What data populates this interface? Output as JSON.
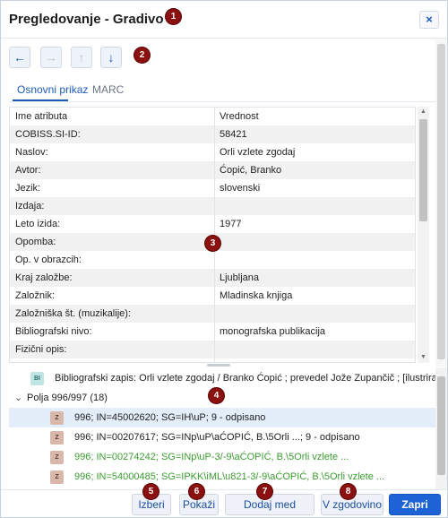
{
  "dialog": {
    "title": "Pregledovanje - Gradivo",
    "close_label": "×"
  },
  "nav": {
    "back_icon": "←",
    "forward_icon": "→",
    "up_icon": "↑",
    "down_icon": "↓"
  },
  "tabs": [
    {
      "label": "Osnovni prikaz",
      "active": true
    },
    {
      "label": "MARC",
      "active": false
    }
  ],
  "table": {
    "headers": [
      "Ime atributa",
      "Vrednost"
    ],
    "rows": [
      [
        "COBISS.SI-ID:",
        "58421"
      ],
      [
        "Naslov:",
        "Orli vzlete zgodaj"
      ],
      [
        "Avtor:",
        "Ćopić, Branko"
      ],
      [
        "Jezik:",
        "slovenski"
      ],
      [
        "Izdaja:",
        ""
      ],
      [
        "Leto izida:",
        "1977"
      ],
      [
        "Opomba:",
        ""
      ],
      [
        "Op. v obrazcih:",
        ""
      ],
      [
        "Kraj založbe:",
        "Ljubljana"
      ],
      [
        "Založnik:",
        "Mladinska knjiga"
      ],
      [
        "Založniška št. (muzikalije):",
        ""
      ],
      [
        "Bibliografski nivo:",
        "monografska publikacija"
      ],
      [
        "Fizični opis:",
        ""
      ]
    ]
  },
  "tree": {
    "bib_icon": "BI",
    "bib_text": "Bibliografski zapis: Orli vzlete zgodaj / Branko Ćopić ; prevedel Jože Zupančič ; [ilustriral .",
    "group_toggle": "⌄",
    "group_label": "Polja 996/997 (18)",
    "item_icon": "Z",
    "items": [
      {
        "text": "996; IN=45002620; SG=IH\\uP; 9 - odpisano",
        "green": false
      },
      {
        "text": "996; IN=00207617; SG=INp\\uP\\aĆOPIĆ, B.\\5Orli ...; 9 - odpisano",
        "green": false
      },
      {
        "text": "996; IN=00274242; SG=INp\\uP-3/-9\\aĆOPIĆ, B.\\5Orli vzlete ...",
        "green": true
      },
      {
        "text": "996; IN=54000485; SG=IPKK\\iML\\u821-3/-9\\aĆOPIĆ, B.\\5Orli vzlete ...",
        "green": true
      }
    ]
  },
  "footer": {
    "select_label": "Izberi",
    "show_label": "Pokaži",
    "add_label": "Dodaj med bližnjice",
    "history_label": "V zgodovino",
    "close_label": "Zapri"
  },
  "markers": [
    "1",
    "2",
    "3",
    "4",
    "5",
    "6",
    "7",
    "8"
  ],
  "colors": {
    "accent": "#1a5bb5",
    "primary_button": "#1d63d6",
    "marker": "#8b1010",
    "status_green": "#3a9d2f"
  }
}
